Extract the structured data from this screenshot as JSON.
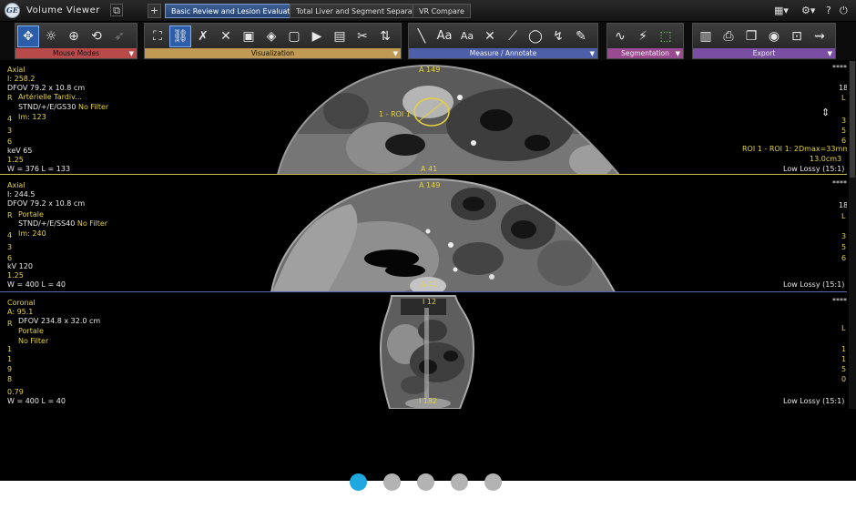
{
  "app": {
    "title": "Volume Viewer",
    "logo_text": "GE"
  },
  "tabs": [
    {
      "label": "Basic Review and Lesion Evaluation",
      "active": true
    },
    {
      "label": "Total Liver and Segment Separation",
      "active": false
    },
    {
      "label": "VR Compare",
      "active": false
    }
  ],
  "add_tab_label": "+",
  "toolbar": {
    "groups": [
      {
        "label": "Mouse Modes",
        "color": "#b94a4a"
      },
      {
        "label": "Visualization",
        "color": "#c09a52"
      },
      {
        "label": "Measure / Annotate",
        "color": "#4d5fa8"
      },
      {
        "label": "Segmentation",
        "color": "#9a4a90"
      },
      {
        "label": "Export",
        "color": "#7a4fa3"
      }
    ],
    "text_tool_label": "Aa",
    "text_tool2_label": "Aa"
  },
  "viewports": [
    {
      "orientation": "Axial",
      "position": "I: 258.2",
      "dfov": "DFOV 79.2 x 10.8 cm",
      "side_left": "R",
      "side_right": "L",
      "series": "Artérielle Tardiv...",
      "recon": "STND/+/E/GS30",
      "filter": "No Filter",
      "image": "Im: 123",
      "left_nums": [
        "4",
        "3",
        "6"
      ],
      "right_nums": [
        "3",
        "5",
        "6"
      ],
      "kv": "keV 65",
      "thickness": "1.25",
      "wl": "W = 376 L = 133",
      "top_marker": "A 149",
      "bottom_marker": "A 41",
      "right_top": "18",
      "roi_label": "1 - ROI 1",
      "roi_measure": "ROI 1 - ROI 1: 2Dmax=33mm",
      "roi_volume": "13.0cm3",
      "compression": "Low Lossy (15:1)",
      "corner_dots": "****"
    },
    {
      "orientation": "Axial",
      "position": "I: 244.5",
      "dfov": "DFOV 79.2 x 10.8 cm",
      "side_left": "R",
      "side_right": "L",
      "series": "Portale",
      "recon": "STND/+/E/SS40",
      "filter": "No Filter",
      "image": "Im: 240",
      "left_nums": [
        "4",
        "3",
        "6"
      ],
      "right_nums": [
        "3",
        "5",
        "6"
      ],
      "kv": "kV 120",
      "thickness": "1.25",
      "wl": "W = 400 L = 40",
      "top_marker": "A 149",
      "bottom_marker": "A 41",
      "right_top": "18",
      "compression": "Low Lossy (15:1)",
      "corner_dots": "****"
    },
    {
      "orientation": "Coronal",
      "position": "A: 95.1",
      "dfov": "DFOV 234.8 x 32.0 cm",
      "side_left": "R",
      "side_right": "L",
      "series": "Portale",
      "filter": "No Filter",
      "left_nums": [
        "1",
        "1",
        "9",
        "8"
      ],
      "right_nums": [
        "1",
        "1",
        "5",
        "0"
      ],
      "thickness": "0.79",
      "wl": "W = 400 L = 40",
      "top_marker": "I 12",
      "bottom_marker": "I 182",
      "compression": "Low Lossy (15:1)",
      "corner_dots": "****"
    }
  ],
  "pager": {
    "count": 5,
    "active_index": 0
  },
  "colors": {
    "annotation": "#e5d23a",
    "active_tab": "#2b5da8",
    "pager_active": "#1ea8df",
    "pager_inactive": "#b3b3b3"
  }
}
